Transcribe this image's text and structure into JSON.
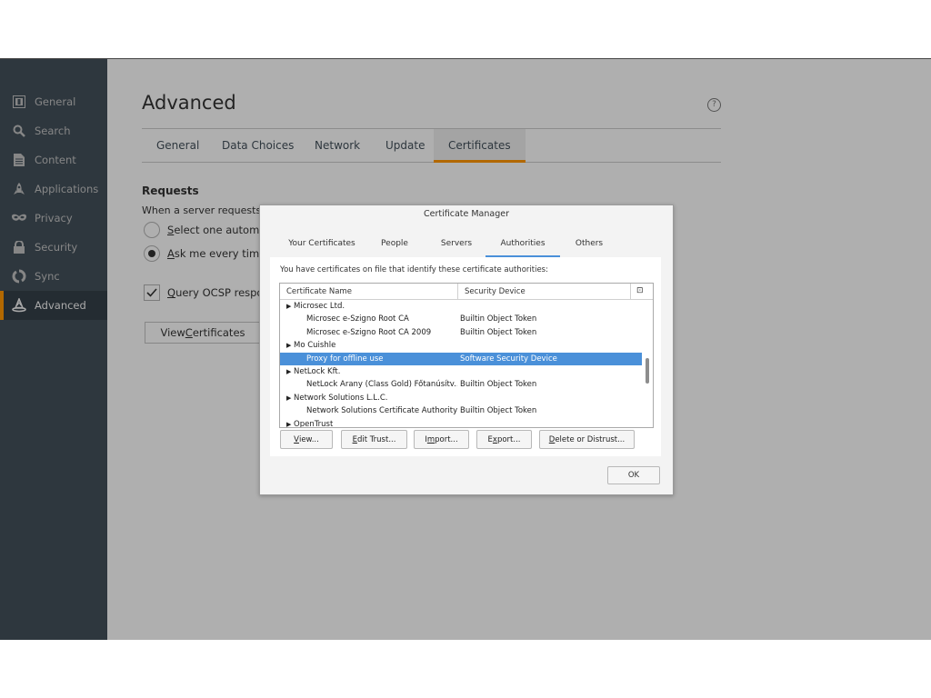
{
  "sidebar": {
    "items": [
      {
        "label": "General",
        "icon": "general-icon"
      },
      {
        "label": "Search",
        "icon": "search-icon"
      },
      {
        "label": "Content",
        "icon": "document-icon"
      },
      {
        "label": "Applications",
        "icon": "rocket-icon"
      },
      {
        "label": "Privacy",
        "icon": "mask-icon"
      },
      {
        "label": "Security",
        "icon": "lock-icon"
      },
      {
        "label": "Sync",
        "icon": "sync-icon"
      },
      {
        "label": "Advanced",
        "icon": "wizard-hat-icon",
        "selected": true
      }
    ]
  },
  "main": {
    "title": "Advanced",
    "help_icon": "?",
    "tabs": [
      "General",
      "Data Choices",
      "Network",
      "Update",
      "Certificates"
    ],
    "active_tab": "Certificates",
    "requests": {
      "title": "Requests",
      "description": "When a server requests m",
      "option_auto": "Select one automat",
      "option_ask": "Ask me every time",
      "ocsp": "Query OCSP respor",
      "view_button": "View Certificates"
    }
  },
  "dialog": {
    "title": "Certificate Manager",
    "tabs": [
      "Your Certificates",
      "People",
      "Servers",
      "Authorities",
      "Others"
    ],
    "active_tab": "Authorities",
    "description": "You have certificates on file that identify these certificate authorities:",
    "columns": {
      "name": "Certificate Name",
      "device": "Security Device",
      "picker": "⊡"
    },
    "rows": [
      {
        "name": "Microsec Ltd.",
        "device": "",
        "group": true
      },
      {
        "name": "Microsec e-Szigno Root CA",
        "device": "Builtin Object Token",
        "group": false
      },
      {
        "name": "Microsec e-Szigno Root CA 2009",
        "device": "Builtin Object Token",
        "group": false
      },
      {
        "name": "Mo Cuishle",
        "device": "",
        "group": true
      },
      {
        "name": "Proxy for offline use",
        "device": "Software Security Device",
        "group": false,
        "selected": true
      },
      {
        "name": "NetLock Kft.",
        "device": "",
        "group": true
      },
      {
        "name": "NetLock Arany (Class Gold) Főtanúsítv...",
        "device": "Builtin Object Token",
        "group": false
      },
      {
        "name": "Network Solutions L.L.C.",
        "device": "",
        "group": true
      },
      {
        "name": "Network Solutions Certificate Authority",
        "device": "Builtin Object Token",
        "group": false
      },
      {
        "name": "OpenTrust",
        "device": "",
        "group": true
      }
    ],
    "buttons": {
      "view": {
        "pre": "",
        "key": "V",
        "post": "iew..."
      },
      "edit": {
        "pre": "",
        "key": "E",
        "post": "dit Trust..."
      },
      "import": {
        "pre": "I",
        "key": "m",
        "post": "port..."
      },
      "export": {
        "pre": "E",
        "key": "x",
        "post": "port..."
      },
      "delete": {
        "pre": "",
        "key": "D",
        "post": "elete or Distrust..."
      }
    },
    "ok": "OK"
  },
  "colors": {
    "sidebar": "#424f5a",
    "accent": "#ff9500",
    "selection": "#4a90d9"
  }
}
